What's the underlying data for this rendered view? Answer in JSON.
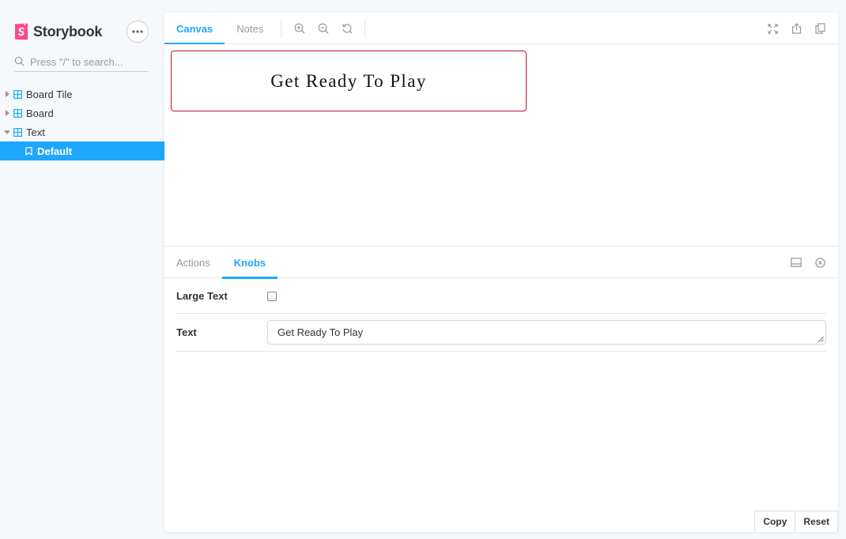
{
  "brand": {
    "name": "Storybook",
    "accent": "#ff4785"
  },
  "sidebar": {
    "search_placeholder": "Press \"/\" to search...",
    "items": [
      {
        "label": "Board Tile",
        "expanded": false,
        "icon": "component-icon"
      },
      {
        "label": "Board",
        "expanded": false,
        "icon": "component-icon"
      },
      {
        "label": "Text",
        "expanded": true,
        "icon": "component-icon"
      }
    ],
    "selected_story": {
      "label": "Default",
      "icon": "bookmark-icon"
    }
  },
  "toolbar": {
    "tabs": [
      {
        "label": "Canvas",
        "active": true
      },
      {
        "label": "Notes",
        "active": false
      }
    ],
    "tools": [
      "zoom-in-icon",
      "zoom-out-icon",
      "reset-zoom-icon"
    ],
    "right_tools": [
      "fullscreen-icon",
      "share-icon",
      "copy-icon"
    ]
  },
  "canvas": {
    "story_text": "Get Ready To Play",
    "border_color": "#c8102e"
  },
  "addons": {
    "tabs": [
      {
        "label": "Actions",
        "active": false
      },
      {
        "label": "Knobs",
        "active": true
      }
    ],
    "right_tools": [
      "panel-position-icon",
      "close-panel-icon"
    ],
    "knobs": [
      {
        "label": "Large Text",
        "type": "boolean",
        "checked": false
      },
      {
        "label": "Text",
        "type": "text",
        "value": "Get Ready To Play"
      }
    ],
    "buttons": {
      "copy": "Copy",
      "reset": "Reset"
    }
  },
  "colors": {
    "selected_bg": "#1ea7fd",
    "active_tab": "#1ea7fd",
    "inactive_tab": "#999999"
  }
}
